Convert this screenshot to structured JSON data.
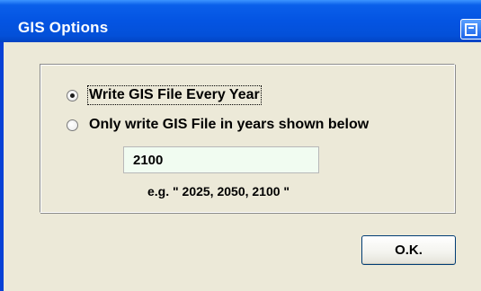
{
  "window": {
    "title": "GIS Options"
  },
  "options": {
    "write_every_year_label": "Write GIS File Every Year",
    "write_selected_years_label": "Only write GIS File in years shown below",
    "selected": "write_every_year"
  },
  "years_input": {
    "value": "2100"
  },
  "hint": "e.g. \" 2025, 2050, 2100 \"",
  "ok_label": "O.K."
}
